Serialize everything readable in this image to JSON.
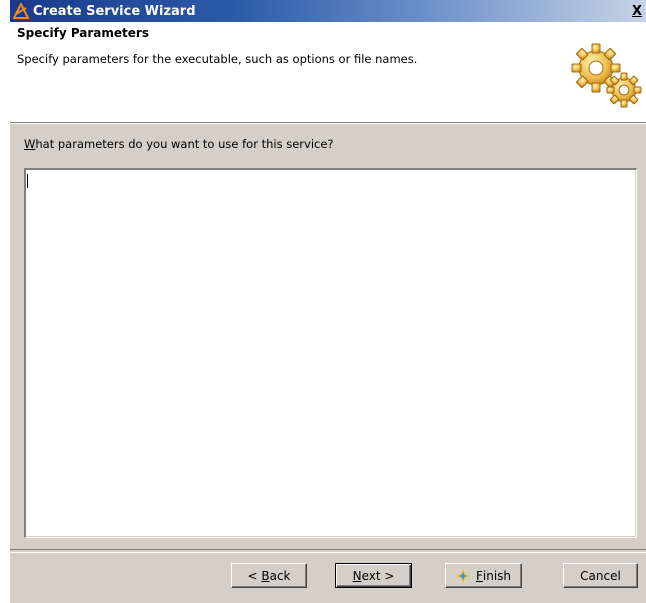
{
  "window": {
    "title": "Create Service Wizard",
    "close_glyph": "X"
  },
  "header": {
    "title": "Specify Parameters",
    "subtitle": "Specify parameters for the executable, such as options or file names.",
    "icon": "gears-icon"
  },
  "question": {
    "mnemonic": "W",
    "rest": "hat parameters do you want to use for this service?"
  },
  "parameters": {
    "value": ""
  },
  "buttons": {
    "back": {
      "prefix": "< ",
      "mnemonic": "B",
      "rest": "ack"
    },
    "next": {
      "mnemonic": "N",
      "rest": "ext >"
    },
    "finish": {
      "mnemonic": "F",
      "rest": "inish",
      "icon": "finish-flag-icon"
    },
    "cancel": {
      "label": "Cancel"
    }
  },
  "colors": {
    "titlebar_start": "#1a3a8a",
    "titlebar_end": "#c7d3e6",
    "dialog_bg": "#d4d0c8",
    "gear_color": "#e0a830"
  }
}
